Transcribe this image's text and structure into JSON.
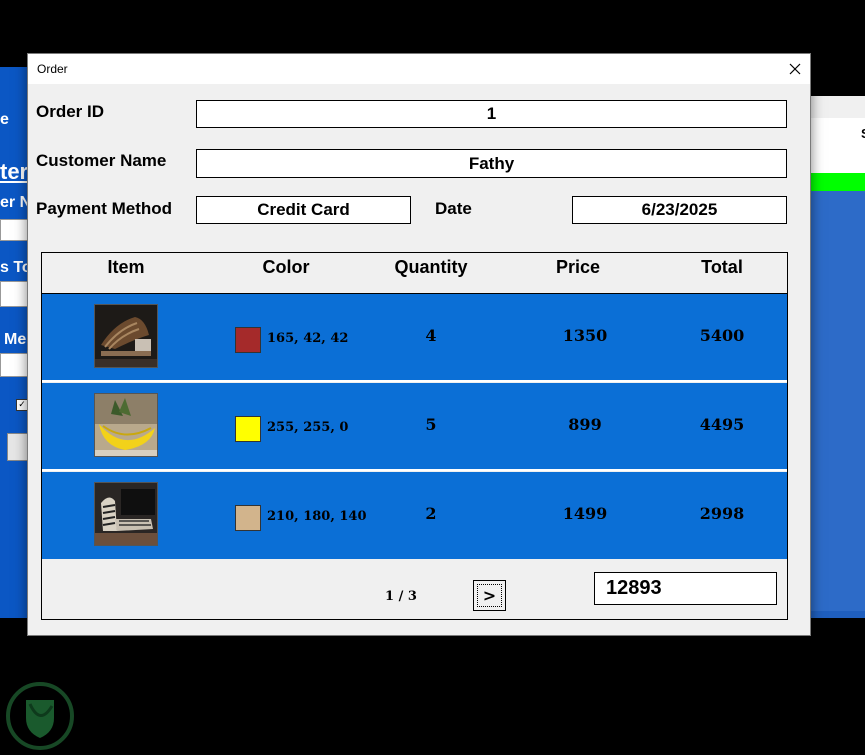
{
  "window": {
    "title": "Order"
  },
  "form": {
    "order_id_label": "Order ID",
    "order_id_value": "1",
    "customer_label": "Customer Name",
    "customer_value": "Fathy",
    "payment_label": "Payment Method",
    "payment_value": "Credit Card",
    "date_label": "Date",
    "date_value": "6/23/2025"
  },
  "table": {
    "headers": {
      "item": "Item",
      "color": "Color",
      "quantity": "Quantity",
      "price": "Price",
      "total": "Total"
    },
    "rows": [
      {
        "color_rgb": "165, 42, 42",
        "color_hex": "#a52a2a",
        "quantity": "4",
        "price": "1350",
        "total": "5400",
        "thumb": "dark-chair"
      },
      {
        "color_rgb": "255, 255, 0",
        "color_hex": "#ffff00",
        "quantity": "5",
        "price": "899",
        "total": "4495",
        "thumb": "banana-sofa"
      },
      {
        "color_rgb": "210, 180, 140",
        "color_hex": "#d2b48c",
        "quantity": "2",
        "price": "1499",
        "total": "2998",
        "thumb": "zebra-chair"
      }
    ]
  },
  "footer": {
    "pager": "1 / 3",
    "next_label": ">",
    "grand_total": "12893"
  },
  "background": {
    "fragment_1": "e",
    "fragment_2": "ter",
    "fragment_3": "er N",
    "fragment_4": "s To",
    "fragment_5": "Me",
    "fragment_6": "S"
  },
  "colors": {
    "row_blue": "#0b6fd6",
    "dialog_bg": "#f0f0f0"
  }
}
